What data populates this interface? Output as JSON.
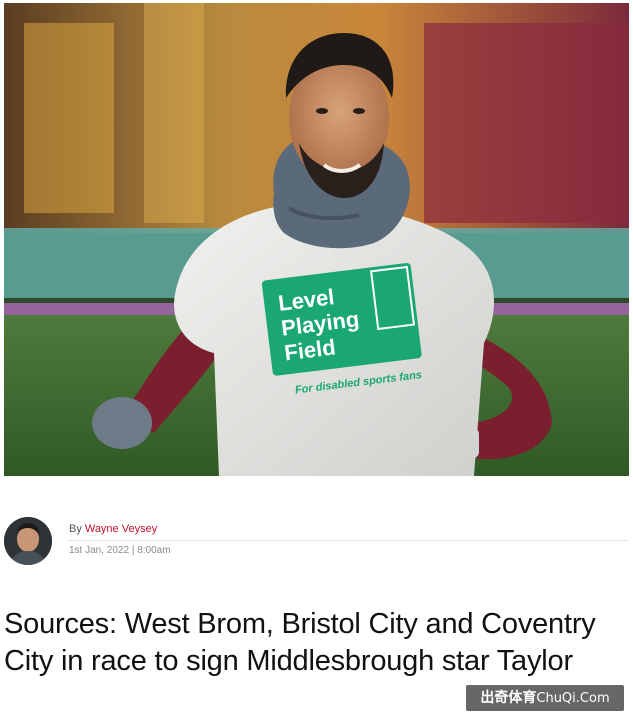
{
  "article": {
    "headline": "Sources: West Brom, Bristol City and Coventry City in race to sign Middlesbrough star Taylor",
    "byline_prefix": "By",
    "author_name": "Wayne Veysey",
    "published": "1st Jan, 2022 | 8:00am"
  },
  "hero_image": {
    "shirt_text_line1": "Level",
    "shirt_text_line2": "Playing",
    "shirt_text_line3": "Field",
    "shirt_tagline": "For disabled sports fans"
  },
  "watermark": {
    "chinese": "出奇体育",
    "domain": "ChuQi.Com"
  },
  "colors": {
    "author_link": "#c8102e",
    "shirt_badge": "#1aa774"
  }
}
